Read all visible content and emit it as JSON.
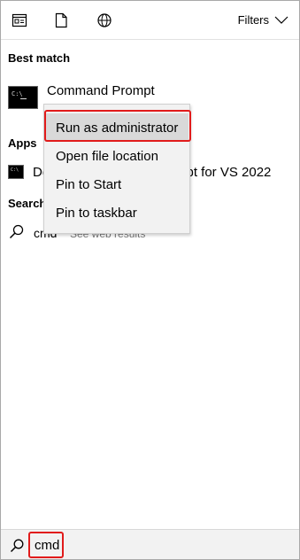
{
  "topbar": {
    "icons": [
      "apps-icon",
      "document-icon",
      "web-icon"
    ],
    "filters_label": "Filters"
  },
  "best_match": {
    "header": "Best match",
    "item": {
      "icon": "command-prompt-icon",
      "title": "Command Prompt"
    }
  },
  "apps": {
    "header": "Apps",
    "item": {
      "icon": "command-prompt-icon",
      "title_start": "De",
      "title_end": "mpt for VS 2022"
    }
  },
  "search_web": {
    "header": "Search",
    "query": "cmd",
    "subtitle": "See web results"
  },
  "context_menu": {
    "items": [
      "Run as administrator",
      "Open file location",
      "Pin to Start",
      "Pin to taskbar"
    ]
  },
  "searchbar": {
    "value": "cmd"
  },
  "colors": {
    "highlight_box": "#e11b1b",
    "menu_bg": "#f2f2f2",
    "menu_hover": "#d9d9d9"
  }
}
